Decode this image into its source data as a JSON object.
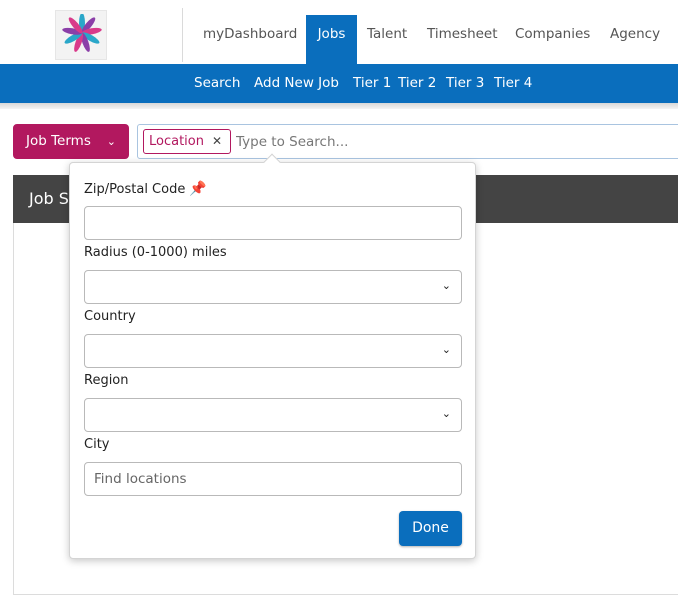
{
  "nav": {
    "items": [
      {
        "label": "myDashboard"
      },
      {
        "label": "Jobs"
      },
      {
        "label": "Talent"
      },
      {
        "label": "Timesheet"
      },
      {
        "label": "Companies"
      },
      {
        "label": "Agency"
      }
    ],
    "active": "Jobs"
  },
  "subnav": {
    "items": [
      {
        "label": "Search"
      },
      {
        "label": "Add New Job"
      },
      {
        "label": "Tier 1"
      },
      {
        "label": "Tier 2"
      },
      {
        "label": "Tier 3"
      },
      {
        "label": "Tier 4"
      }
    ]
  },
  "search": {
    "job_terms_label": "Job Terms",
    "tag_label": "Location",
    "placeholder": "Type to Search..."
  },
  "card": {
    "header_partial": "Job S"
  },
  "location_panel": {
    "zip_label": "Zip/Postal Code",
    "zip_value": "",
    "radius_label": "Radius (0-1000) miles",
    "radius_value": "",
    "country_label": "Country",
    "country_value": "",
    "region_label": "Region",
    "region_value": "",
    "city_label": "City",
    "city_placeholder": "Find locations",
    "done_label": "Done"
  },
  "icons": {
    "pin": "pushpin-icon",
    "chevron": "chevron-down-icon",
    "remove": "close-icon"
  },
  "colors": {
    "primary": "#0a6ebd",
    "accent": "#b2185f",
    "dark_header": "#444444"
  }
}
